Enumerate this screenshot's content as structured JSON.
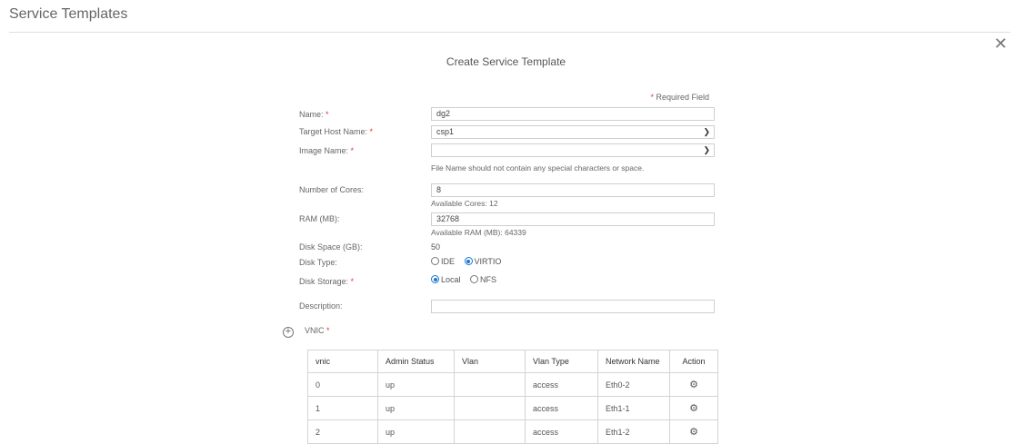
{
  "page": {
    "title": "Service Templates"
  },
  "dialog": {
    "title": "Create Service Template",
    "required_note": "Required Field",
    "required_marker": "*"
  },
  "form": {
    "name": {
      "label": "Name:",
      "value": "dg2"
    },
    "target_host": {
      "label": "Target Host Name:",
      "value": "csp1"
    },
    "image_name": {
      "label": "Image Name:",
      "value": "",
      "hint": "File Name should not contain any special characters or space."
    },
    "cores": {
      "label": "Number of Cores:",
      "value": "8",
      "hint": "Available Cores: 12"
    },
    "ram": {
      "label": "RAM (MB):",
      "value": "32768",
      "hint": "Available RAM (MB): 64339"
    },
    "disk_space": {
      "label": "Disk Space (GB):",
      "value": "50"
    },
    "disk_type": {
      "label": "Disk Type:",
      "options": [
        "IDE",
        "VIRTIO"
      ],
      "selected": "VIRTIO"
    },
    "disk_storage": {
      "label": "Disk Storage:",
      "options": [
        "Local",
        "NFS"
      ],
      "selected": "Local"
    },
    "description": {
      "label": "Description:",
      "value": ""
    }
  },
  "vnic": {
    "label": "VNIC",
    "add_icon": "plus-circle-icon",
    "columns": [
      "vnic",
      "Admin Status",
      "Vlan",
      "Vlan Type",
      "Network Name",
      "Action"
    ],
    "rows": [
      {
        "vnic": "0",
        "admin_status": "up",
        "vlan": "",
        "vlan_type": "access",
        "network_name": "Eth0-2",
        "action_icon": "gear-icon"
      },
      {
        "vnic": "1",
        "admin_status": "up",
        "vlan": "",
        "vlan_type": "access",
        "network_name": "Eth1-1",
        "action_icon": "gear-icon"
      },
      {
        "vnic": "2",
        "admin_status": "up",
        "vlan": "",
        "vlan_type": "access",
        "network_name": "Eth1-2",
        "action_icon": "gear-icon"
      }
    ]
  },
  "icons": {
    "close": "close-icon",
    "dropdown": "chevron-down-icon"
  },
  "colors": {
    "required": "#e53935",
    "radio_selected": "#1976d2"
  }
}
